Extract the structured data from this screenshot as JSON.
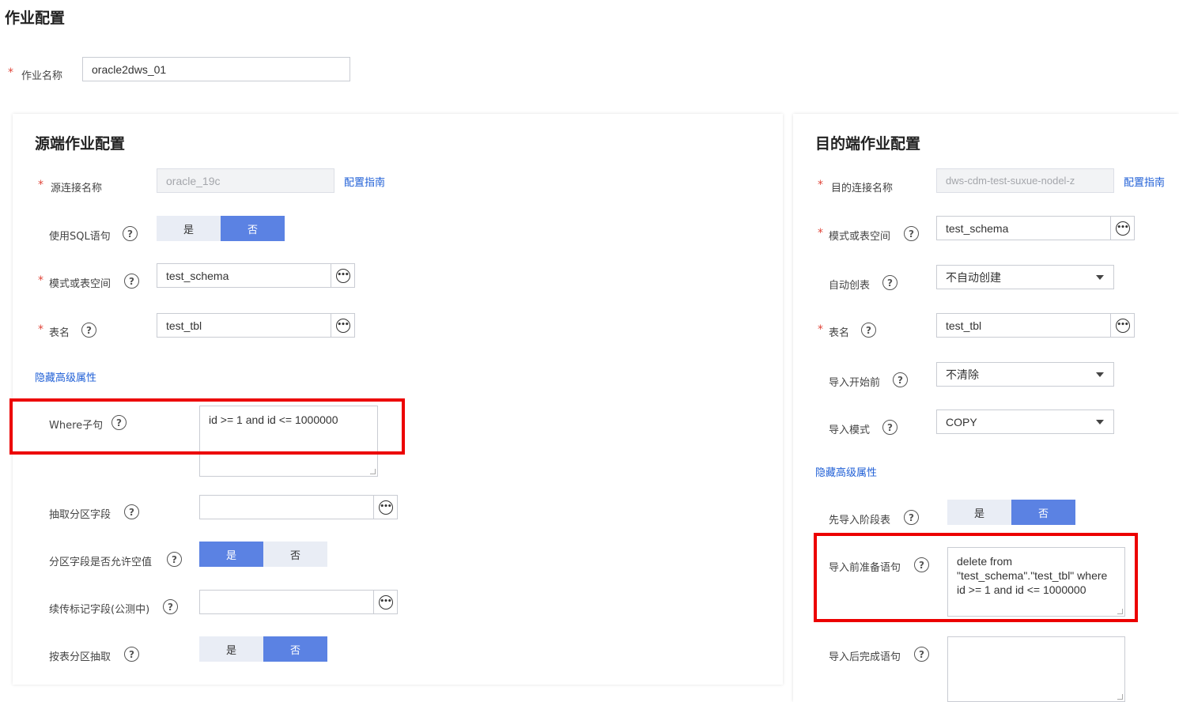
{
  "page": {
    "title": "作业配置"
  },
  "job": {
    "name_label": "作业名称",
    "name_value": "oracle2dws_01"
  },
  "source": {
    "title": "源端作业配置",
    "conn_label": "源连接名称",
    "conn_value": "oracle_19c",
    "guide_link": "配置指南",
    "use_sql_label": "使用SQL语句",
    "use_sql_yes": "是",
    "use_sql_no": "否",
    "schema_label": "模式或表空间",
    "schema_value": "test_schema",
    "table_label": "表名",
    "table_value": "test_tbl",
    "advanced_link": "隐藏高级属性",
    "where_label": "Where子句",
    "where_value": "id >= 1 and id <= 1000000",
    "partition_field_label": "抽取分区字段",
    "partition_field_value": "",
    "partition_null_label": "分区字段是否允许空值",
    "partition_null_yes": "是",
    "partition_null_no": "否",
    "resume_label": "续传标记字段(公测中)",
    "resume_value": "",
    "by_partition_label": "按表分区抽取",
    "by_partition_yes": "是",
    "by_partition_no": "否"
  },
  "dest": {
    "title": "目的端作业配置",
    "conn_label": "目的连接名称",
    "conn_value": "dws-cdm-test-suxue-nodel-z",
    "guide_link": "配置指南",
    "schema_label": "模式或表空间",
    "schema_value": "test_schema",
    "auto_create_label": "自动创表",
    "auto_create_value": "不自动创建",
    "table_label": "表名",
    "table_value": "test_tbl",
    "before_import_label": "导入开始前",
    "before_import_value": "不清除",
    "import_mode_label": "导入模式",
    "import_mode_value": "COPY",
    "advanced_link": "隐藏高级属性",
    "stage_label": "先导入阶段表",
    "stage_yes": "是",
    "stage_no": "否",
    "prepare_label": "导入前准备语句",
    "prepare_value": "delete from \"test_schema\".\"test_tbl\" where id >= 1 and id <= 1000000",
    "complete_label": "导入后完成语句",
    "complete_value": ""
  },
  "icons": {
    "help": "question-circle-icon",
    "more": "ellipsis-circle-icon",
    "dropdown": "caret-down-icon"
  },
  "colors": {
    "accent": "#5b82e3",
    "required": "#e0463a",
    "link": "#1f5fd6",
    "highlight": "#ec0000"
  }
}
